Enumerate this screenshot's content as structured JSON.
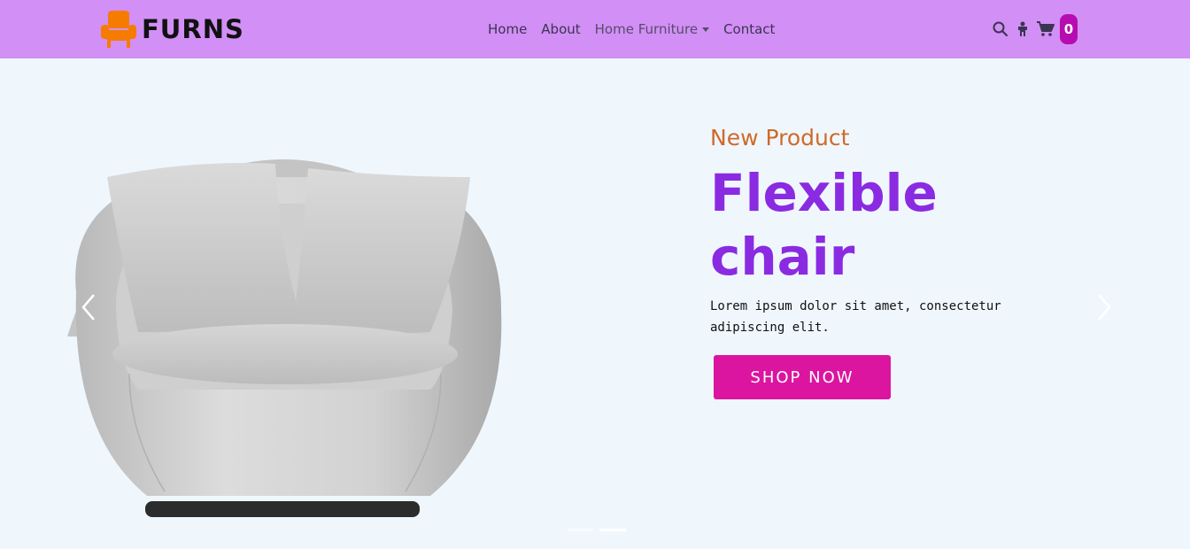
{
  "brand": {
    "name": "FURNS",
    "logo_icon": "armchair-icon",
    "logo_color": "#f57c00"
  },
  "nav": {
    "links": [
      {
        "label": "Home"
      },
      {
        "label": "About"
      },
      {
        "label": "Home Furniture",
        "dropdown": true
      },
      {
        "label": "Contact"
      }
    ],
    "icons": [
      "search-icon",
      "user-icon",
      "cart-icon"
    ],
    "cart_count": "0",
    "background_color": "#d28ff5"
  },
  "hero": {
    "subtitle": "New Product",
    "title_line1": "Flexible",
    "title_line2": "chair",
    "description": "Lorem ipsum dolor sit amet, consectetur adipiscing elit.",
    "button_label": "SHOP NOW",
    "image": "grey-armchair-with-pillows",
    "prev_icon": "chevron-left-icon",
    "next_icon": "chevron-right-icon",
    "slides": 2,
    "active_slide": 2,
    "colors": {
      "subtitle": "#cf6a2a",
      "title": "#8a2be2",
      "button": "#db159f"
    }
  }
}
